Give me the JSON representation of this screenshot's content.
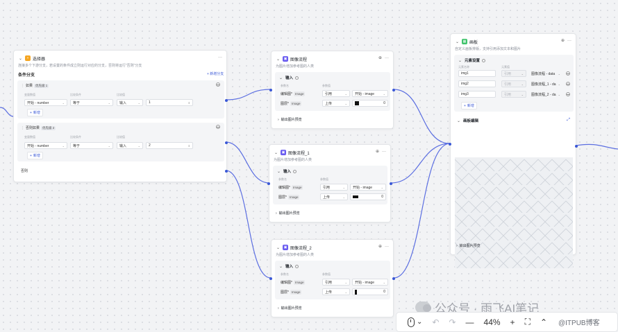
{
  "colors": {
    "accent": "#3a58d6",
    "selector_icon": "#f5a623",
    "image_icon": "#6a5cf0",
    "canvas_icon": "#41c36c"
  },
  "selector_node": {
    "title": "选择器",
    "desc": "连接多个下游分支，若设置的条件成立则运行对应的分支，否则将运行“否则”分支",
    "section_title": "条件分支",
    "add_branch": "+ 新增分支",
    "branches": [
      {
        "label": "如果",
        "priority": "优先级 1",
        "hint_left": "变量数值",
        "hint_mid": "比较条件",
        "hint_right": "比较值",
        "var": "开始 - number",
        "op": "等于",
        "mode": "输入",
        "value": "1",
        "add": "新增"
      },
      {
        "label": "否则如果",
        "priority": "优先级 2",
        "hint_left": "变量数值",
        "hint_mid": "比较条件",
        "hint_right": "比较值",
        "var": "开始 - number",
        "op": "等于",
        "mode": "输入",
        "value": "2",
        "add": "新增"
      }
    ],
    "else_label": "否则"
  },
  "image_nodes": [
    {
      "title": "图像流程",
      "desc": "为图片增加参考图的人类",
      "input_title": "输入",
      "hdr_name": "参数名",
      "hdr_value": "参数值",
      "rows": [
        {
          "name": "编辑图*",
          "type": "Image",
          "mode": "引用",
          "value": "开始 - image"
        },
        {
          "name": "图层*",
          "type": "Image",
          "mode": "上传",
          "value": "0"
        }
      ],
      "output": "输出图片预览"
    },
    {
      "title": "图像流程_1",
      "desc": "为图片增加参考图的人类",
      "input_title": "输入",
      "hdr_name": "参数名",
      "hdr_value": "参数值",
      "rows": [
        {
          "name": "编辑图*",
          "type": "Image",
          "mode": "引用",
          "value": "开始 - image"
        },
        {
          "name": "图层*",
          "type": "Image",
          "mode": "上传",
          "value": "0"
        }
      ],
      "output": "输出图片预览"
    },
    {
      "title": "图像流程_2",
      "desc": "为图片增加参考图的人类",
      "input_title": "输入",
      "hdr_name": "参数名",
      "hdr_value": "参数值",
      "rows": [
        {
          "name": "编辑图*",
          "type": "Image",
          "mode": "引用",
          "value": "开始 - image"
        },
        {
          "name": "图层*",
          "type": "Image",
          "mode": "上传",
          "value": "0"
        }
      ],
      "output": "输出图片预览"
    }
  ],
  "canvas_node": {
    "title": "画板",
    "desc": "自定义画板排版，支持引用添加文本和图片",
    "elements_title": "元素设置",
    "hdr_name": "元素名称",
    "hdr_mode": "元素值",
    "rows": [
      {
        "name": "img1",
        "mode": "引用",
        "value": "图像流程 - data"
      },
      {
        "name": "img2",
        "mode": "引用",
        "value": "图像流程_1 - da"
      },
      {
        "name": "img3",
        "mode": "引用",
        "value": "图像流程_2 - da"
      }
    ],
    "add": "新增",
    "canvas_edit": "画板编辑",
    "output": "输出图片预览"
  },
  "toolbar": {
    "zoom": "44%",
    "minus": "—",
    "plus": "+",
    "undo": "↶",
    "redo": "↷",
    "more": "⌃"
  },
  "watermark": {
    "text": "公众号 · 雨飞AI笔记",
    "sub": "@ITPUB博客"
  }
}
